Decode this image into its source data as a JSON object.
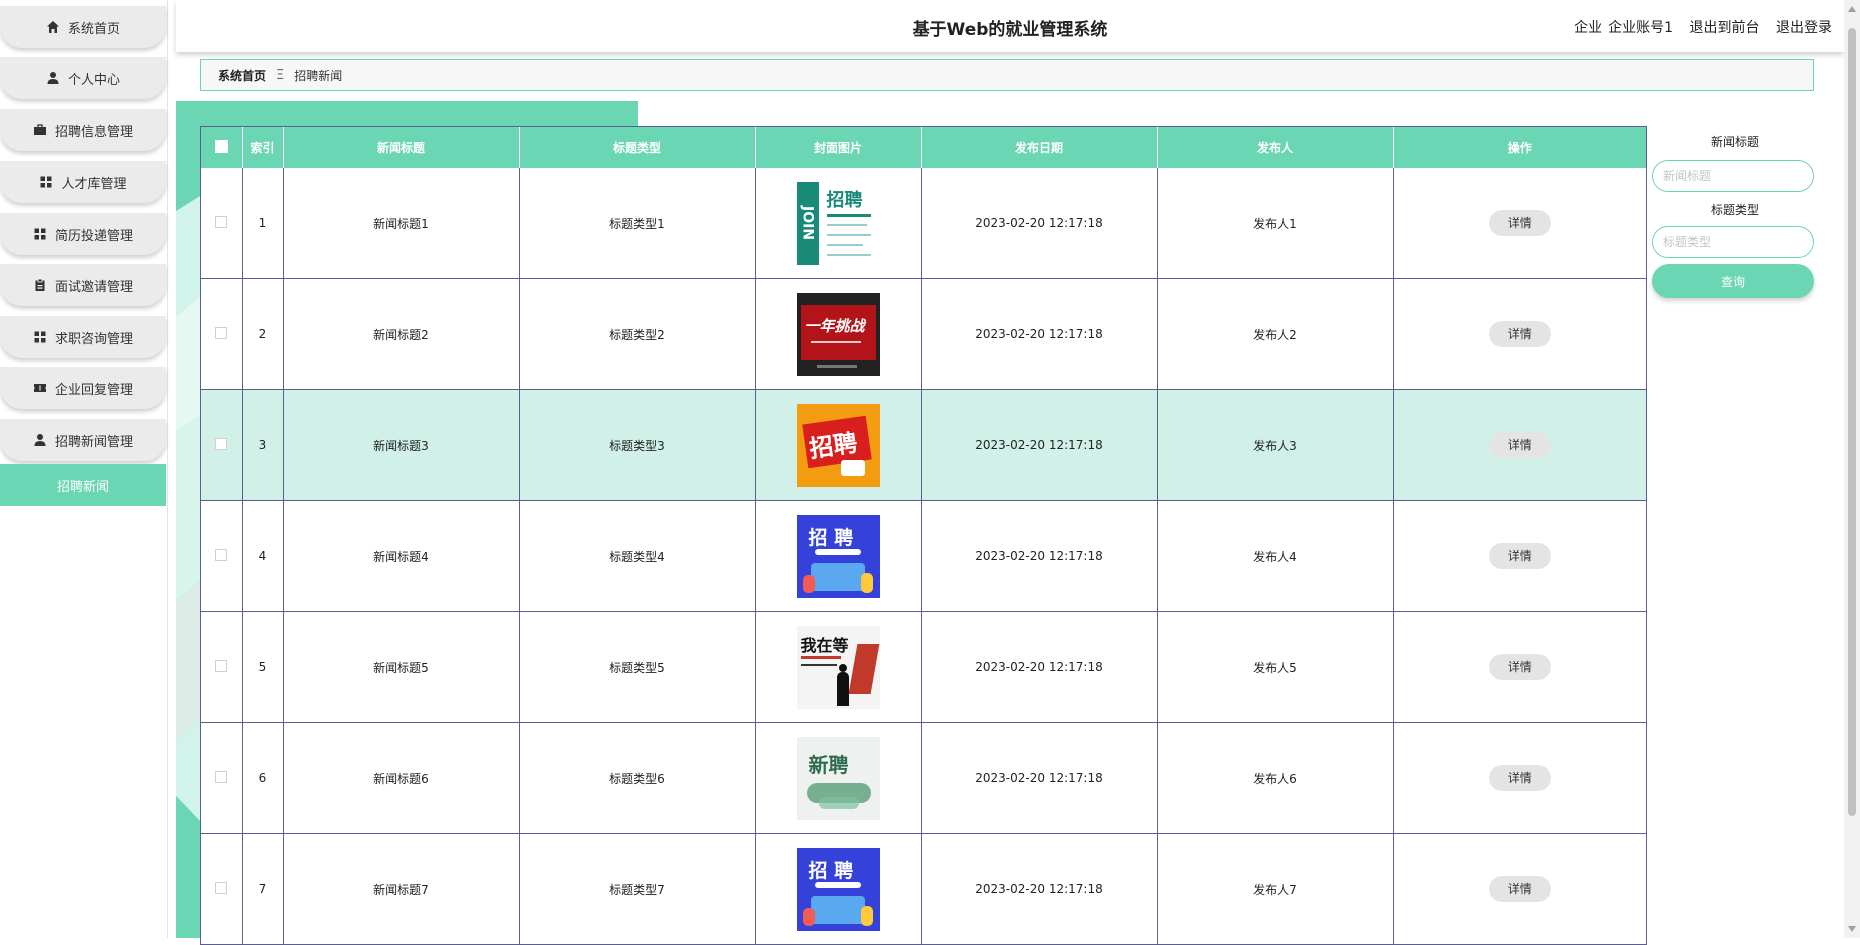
{
  "header": {
    "title": "基于Web的就业管理系统",
    "role": "企业",
    "account": "企业账号1",
    "back_to_front": "退出到前台",
    "logout": "退出登录"
  },
  "sidebar": {
    "items": [
      {
        "label": "系统首页",
        "icon": "home-icon"
      },
      {
        "label": "个人中心",
        "icon": "user-icon"
      },
      {
        "label": "招聘信息管理",
        "icon": "briefcase-icon"
      },
      {
        "label": "人才库管理",
        "icon": "grid-icon"
      },
      {
        "label": "简历投递管理",
        "icon": "grid-icon"
      },
      {
        "label": "面试邀请管理",
        "icon": "clipboard-icon"
      },
      {
        "label": "求职咨询管理",
        "icon": "grid-icon"
      },
      {
        "label": "企业回复管理",
        "icon": "ticket-icon"
      },
      {
        "label": "招聘新闻管理",
        "icon": "user-icon"
      },
      {
        "label": "招聘新闻",
        "icon": "",
        "active": true
      }
    ]
  },
  "breadcrumb": {
    "home": "系统首页",
    "separator": "Ξ",
    "current": "招聘新闻"
  },
  "table": {
    "columns": [
      "",
      "索引",
      "新闻标题",
      "标题类型",
      "封面图片",
      "发布日期",
      "发布人",
      "操作"
    ],
    "rows": [
      {
        "index": "1",
        "title": "新闻标题1",
        "type": "标题类型1",
        "date": "2023-02-20 12:17:18",
        "publisher": "发布人1",
        "action": "详情",
        "cover_text": "招聘"
      },
      {
        "index": "2",
        "title": "新闻标题2",
        "type": "标题类型2",
        "date": "2023-02-20 12:17:18",
        "publisher": "发布人2",
        "action": "详情",
        "cover_text": "一年挑战"
      },
      {
        "index": "3",
        "title": "新闻标题3",
        "type": "标题类型3",
        "date": "2023-02-20 12:17:18",
        "publisher": "发布人3",
        "action": "详情",
        "cover_text": "招聘"
      },
      {
        "index": "4",
        "title": "新闻标题4",
        "type": "标题类型4",
        "date": "2023-02-20 12:17:18",
        "publisher": "发布人4",
        "action": "详情",
        "cover_text": "招 聘"
      },
      {
        "index": "5",
        "title": "新闻标题5",
        "type": "标题类型5",
        "date": "2023-02-20 12:17:18",
        "publisher": "发布人5",
        "action": "详情",
        "cover_text": "我在等"
      },
      {
        "index": "6",
        "title": "新闻标题6",
        "type": "标题类型6",
        "date": "2023-02-20 12:17:18",
        "publisher": "发布人6",
        "action": "详情",
        "cover_text": "新聘"
      },
      {
        "index": "7",
        "title": "新闻标题7",
        "type": "标题类型7",
        "date": "2023-02-20 12:17:18",
        "publisher": "发布人7",
        "action": "详情",
        "cover_text": "招 聘"
      }
    ]
  },
  "search": {
    "title_label": "新闻标题",
    "title_placeholder": "新闻标题",
    "type_label": "标题类型",
    "type_placeholder": "标题类型",
    "button": "查询"
  },
  "colors": {
    "accent": "#6bd6b3",
    "highlight_row": "#d1f0e8",
    "table_border": "#5b5e8f"
  }
}
